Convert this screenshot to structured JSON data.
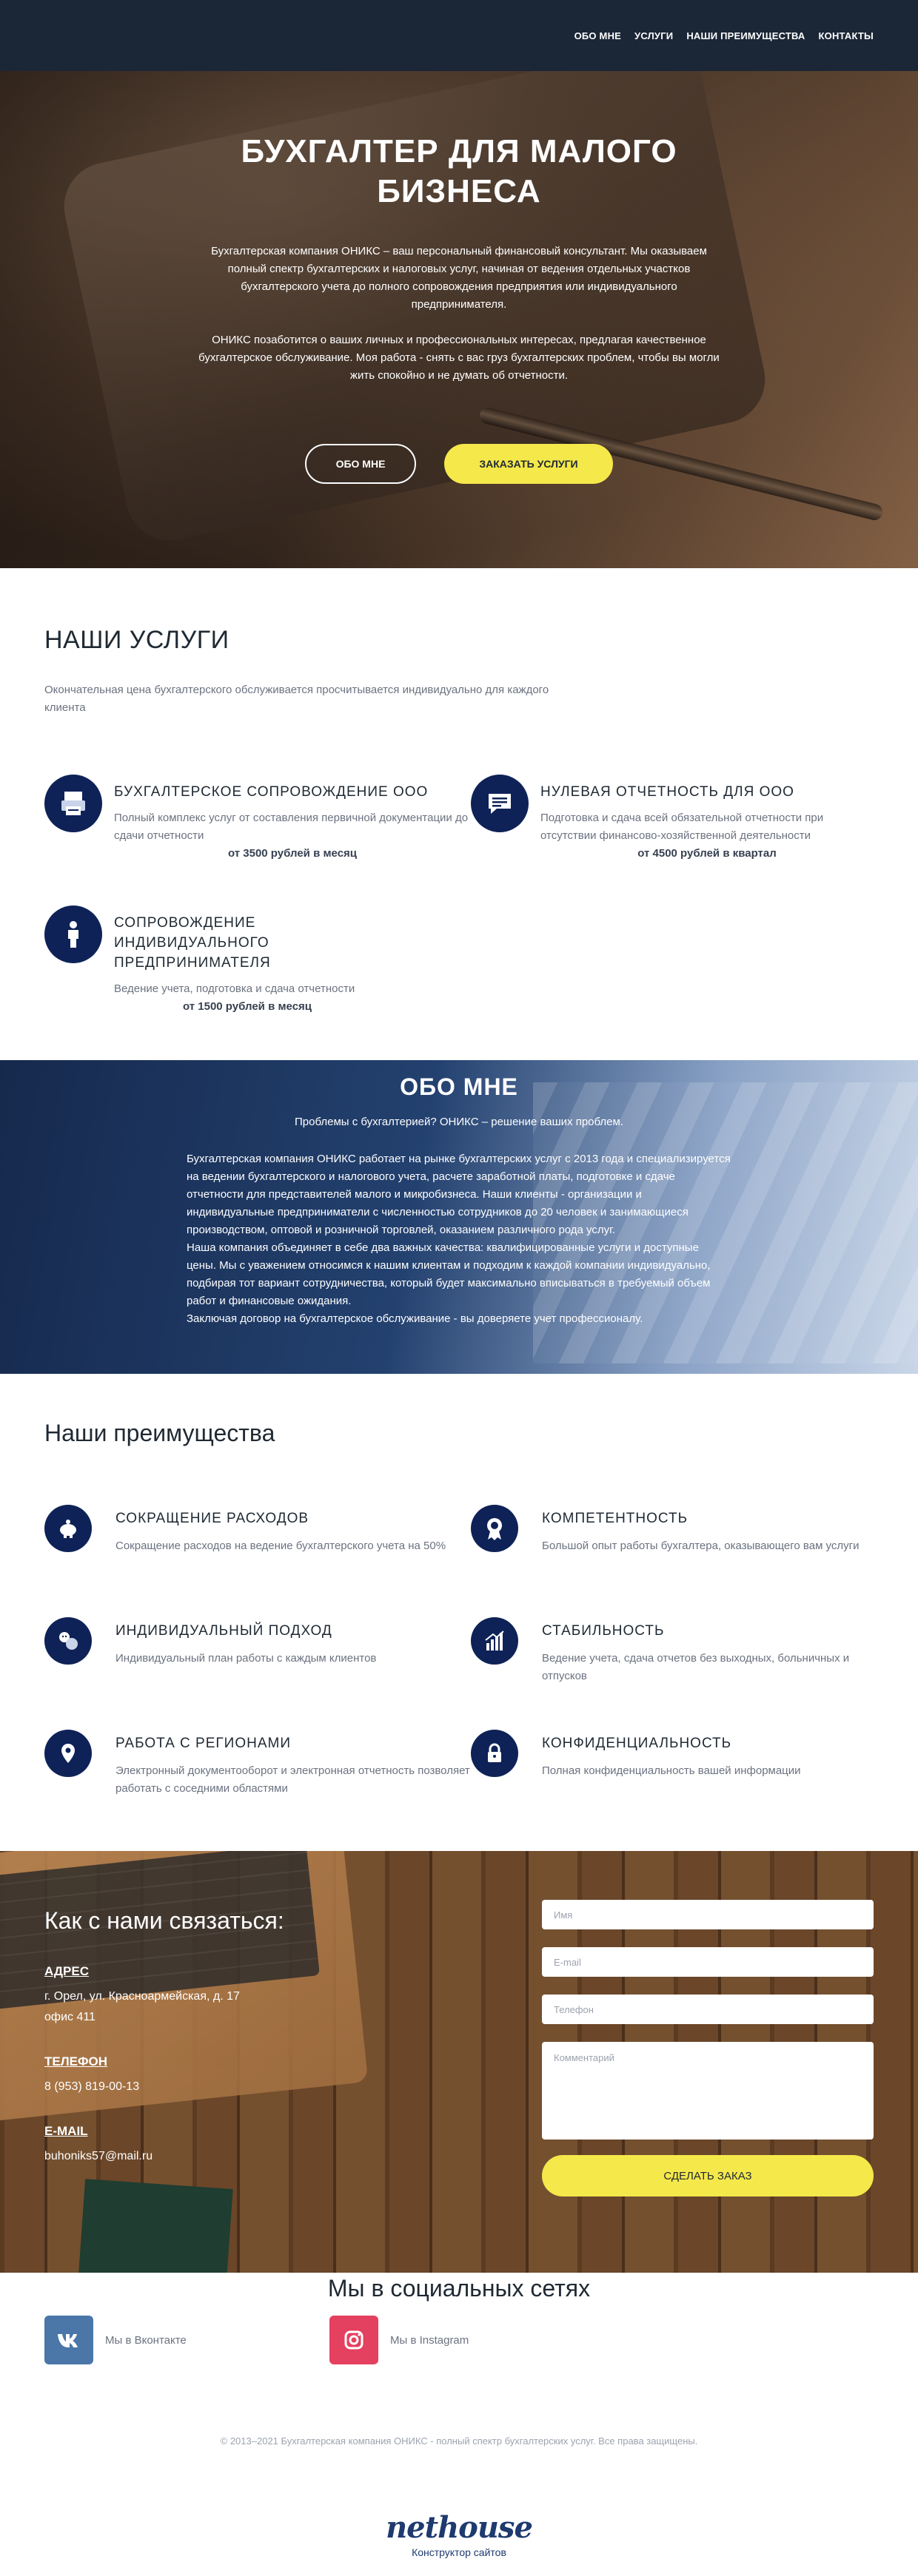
{
  "nav": [
    "ОБО МНЕ",
    "УСЛУГИ",
    "НАШИ ПРЕИМУЩЕСТВА",
    "КОНТАКТЫ"
  ],
  "hero": {
    "title_line1": "БУХГАЛТЕР ДЛЯ МАЛОГО",
    "title_line2": "БИЗНЕСА",
    "p1": "Бухгалтерская компания ОНИКС – ваш персональный финансовый консультант. Мы оказываем полный спектр бухгалтерских и налоговых услуг, начиная от ведения отдельных участков бухгалтерского учета до полного сопровождения предприятия или индивидуального предпринимателя.",
    "p2": "ОНИКС позаботится о ваших личных и профессиональных интересах, предлагая качественное бухгалтерское обслуживание. Моя работа - снять с вас груз бухгалтерских проблем, чтобы вы могли жить спокойно и не думать об отчетности.",
    "btn_about": "ОБО МНЕ",
    "btn_order": "ЗАКАЗАТЬ УСЛУГИ"
  },
  "services": {
    "title": "НАШИ УСЛУГИ",
    "subtitle": "Окончательная цена бухгалтерского обслуживается просчитывается индивидуально для каждого клиента",
    "items": [
      {
        "title": "БУХГАЛТЕРСКОЕ СОПРОВОЖДЕНИЕ ООО",
        "desc": "Полный комплекс услуг от составления первичной документации до сдачи отчетности",
        "price": "от 3500 рублей в месяц",
        "icon": "printer-icon"
      },
      {
        "title": "НУЛЕВАЯ ОТЧЕТНОСТЬ ДЛЯ ООО",
        "desc": "Подготовка и сдача всей обязательной отчетности при отсутствии финансово-хозяйственной деятельности",
        "price": "от 4500 рублей в квартал",
        "icon": "chat-icon"
      },
      {
        "title": "СОПРОВОЖДЕНИЕ ИНДИВИДУАЛЬНОГО ПРЕДПРИНИМАТЕЛЯ",
        "desc": "Ведение учета, подготовка и сдача отчетности",
        "price": "от 1500 рублей в месяц",
        "icon": "person-icon"
      }
    ]
  },
  "about": {
    "title": "ОБО МНЕ",
    "lead": "Проблемы с бухгалтерией? ОНИКС – решение ваших проблем.",
    "text": "Бухгалтерская компания ОНИКС работает на рынке бухгалтерских услуг с 2013 года и специализируется на ведении бухгалтерского и налогового учета, расчете заработной платы, подготовке и сдаче отчетности для представителей малого и микробизнеса. Наши клиенты - организации и индивидуальные предприниматели с численностью сотрудников до 20 человек и занимающиеся производством, оптовой и розничной торговлей, оказанием различного рода услуг.\nНаша компания объединяет в себе два важных качества: квалифицированные услуги и доступные цены. Мы с уважением относимся к нашим клиентам и подходим к каждой компании индивидуально, подбирая тот вариант сотрудничества, который будет максимально вписываться в требуемый объем работ и финансовые ожидания.\nЗаключая договор на бухгалтерское обслуживание - вы доверяете учет профессионалу."
  },
  "advantages": {
    "title": "Наши преимущества",
    "items": [
      {
        "title": "СОКРАЩЕНИЕ РАСХОДОВ",
        "desc": "Сокращение расходов на ведение бухгалтерского учета на 50%",
        "icon": "piggy-bank-icon"
      },
      {
        "title": "КОМПЕТЕНТНОСТЬ",
        "desc": "Большой опыт работы бухгалтера, оказывающего вам услуги",
        "icon": "award-icon"
      },
      {
        "title": "ИНДИВИДУАЛЬНЫЙ ПОДХОД",
        "desc": "Индивидуальный план работы с каждым клиентов",
        "icon": "people-icon"
      },
      {
        "title": "СТАБИЛЬНОСТЬ",
        "desc": "Ведение учета, сдача отчетов без выходных, больничных и отпусков",
        "icon": "growth-chart-icon"
      },
      {
        "title": "РАБОТА С РЕГИОНАМИ",
        "desc": "Электронный документооборот и электронная отчетность позволяет работать с соседними областями",
        "icon": "location-pin-icon"
      },
      {
        "title": "КОНФИДЕНЦИАЛЬНОСТЬ",
        "desc": "Полная конфиденциальность вашей информации",
        "icon": "lock-icon"
      }
    ]
  },
  "contact": {
    "title": "Как с нами связаться:",
    "address_label": "АДРЕС",
    "address_value": "г. Орел, ул. Красноармейская, д. 17\nофис 411",
    "phone_label": "ТЕЛЕФОН",
    "phone_value": "8 (953) 819-00-13",
    "email_label": "E-MAIL",
    "email_value": "buhoniks57@mail.ru",
    "form": {
      "name_placeholder": "Имя",
      "email_placeholder": "E-mail",
      "phone_placeholder": "Телефон",
      "comment_placeholder": "Комментарий",
      "submit": "СДЕЛАТЬ ЗАКАЗ"
    }
  },
  "social": {
    "title": "Мы в социальных сетях",
    "vk": {
      "label": "Мы в Вконтакте",
      "icon": "vk-icon",
      "color": "#4a76a8"
    },
    "instagram": {
      "label": "Мы в Instagram",
      "icon": "instagram-icon",
      "color": "#e4405f"
    }
  },
  "footer": {
    "copyright": "© 2013–2021 Бухгалтерская компания ОНИКС - полный спектр бухгалтерских услуг. Все права защищены.",
    "brand": "nethouse",
    "brand_sub": "Конструктор сайтов"
  },
  "colors": {
    "accent": "#f5e84a",
    "icon_bg": "#0e2257",
    "nav_bg": "#1b2636"
  }
}
